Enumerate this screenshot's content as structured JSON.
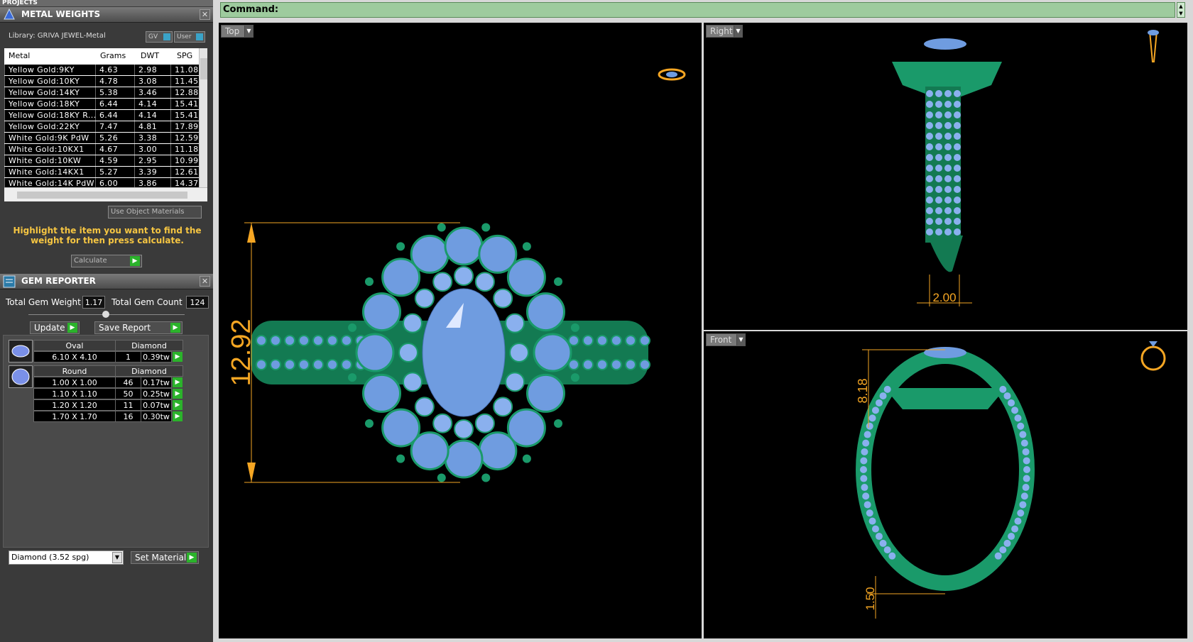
{
  "projects_label": "PROJECTS",
  "metal_panel": {
    "title": "METAL WEIGHTS",
    "library": "Library: GRIVA JEWEL-Metal",
    "toggles": [
      "GV",
      "User"
    ],
    "columns": [
      "Metal",
      "Grams",
      "DWT",
      "SPG"
    ],
    "rows": [
      [
        "Yellow Gold:9KY",
        "4.63",
        "2.98",
        "11.08"
      ],
      [
        "Yellow Gold:10KY",
        "4.78",
        "3.08",
        "11.45"
      ],
      [
        "Yellow Gold:14KY",
        "5.38",
        "3.46",
        "12.88"
      ],
      [
        "Yellow Gold:18KY",
        "6.44",
        "4.14",
        "15.41"
      ],
      [
        "Yellow Gold:18KY R...",
        "6.44",
        "4.14",
        "15.41"
      ],
      [
        "Yellow Gold:22KY",
        "7.47",
        "4.81",
        "17.89"
      ],
      [
        "White Gold:9K PdW",
        "5.26",
        "3.38",
        "12.59"
      ],
      [
        "White Gold:10KX1",
        "4.67",
        "3.00",
        "11.18"
      ],
      [
        "White Gold:10KW",
        "4.59",
        "2.95",
        "10.99"
      ],
      [
        "White Gold:14KX1",
        "5.27",
        "3.39",
        "12.61"
      ],
      [
        "White Gold:14K PdW",
        "6.00",
        "3.86",
        "14.37"
      ]
    ],
    "use_object_materials": "Use Object Materials",
    "hint": "Highlight the item you want to find the weight for then press calculate.",
    "calculate": "Calculate"
  },
  "gem_panel": {
    "title": "GEM REPORTER",
    "total_weight_label": "Total Gem Weight",
    "total_weight": "1.17",
    "total_count_label": "Total Gem Count",
    "total_count": "124",
    "update": "Update",
    "save_report": "Save Report",
    "groups": [
      {
        "shape": "Oval",
        "material": "Diamond",
        "rows": [
          [
            "6.10 X 4.10",
            "1",
            "0.39tw"
          ]
        ]
      },
      {
        "shape": "Round",
        "material": "Diamond",
        "rows": [
          [
            "1.00 X 1.00",
            "46",
            "0.17tw"
          ],
          [
            "1.10 X 1.10",
            "50",
            "0.25tw"
          ],
          [
            "1.20 X 1.20",
            "11",
            "0.07tw"
          ],
          [
            "1.70 X 1.70",
            "16",
            "0.30tw"
          ]
        ]
      }
    ],
    "material_select": "Diamond    (3.52 spg)",
    "set_material": "Set Material"
  },
  "command_label": "Command:",
  "viewports": {
    "top": {
      "label": "Top",
      "dimension": "12.92"
    },
    "right": {
      "label": "Right",
      "dimension": "2.00"
    },
    "front": {
      "label": "Front",
      "dimension_top": "8.18",
      "dimension_bottom": "1.50"
    }
  },
  "colors": {
    "metal": "#1a9a6a",
    "gem": "#7aa6e6",
    "dim": "#f5a623",
    "command_bg": "#9ecb9e"
  }
}
